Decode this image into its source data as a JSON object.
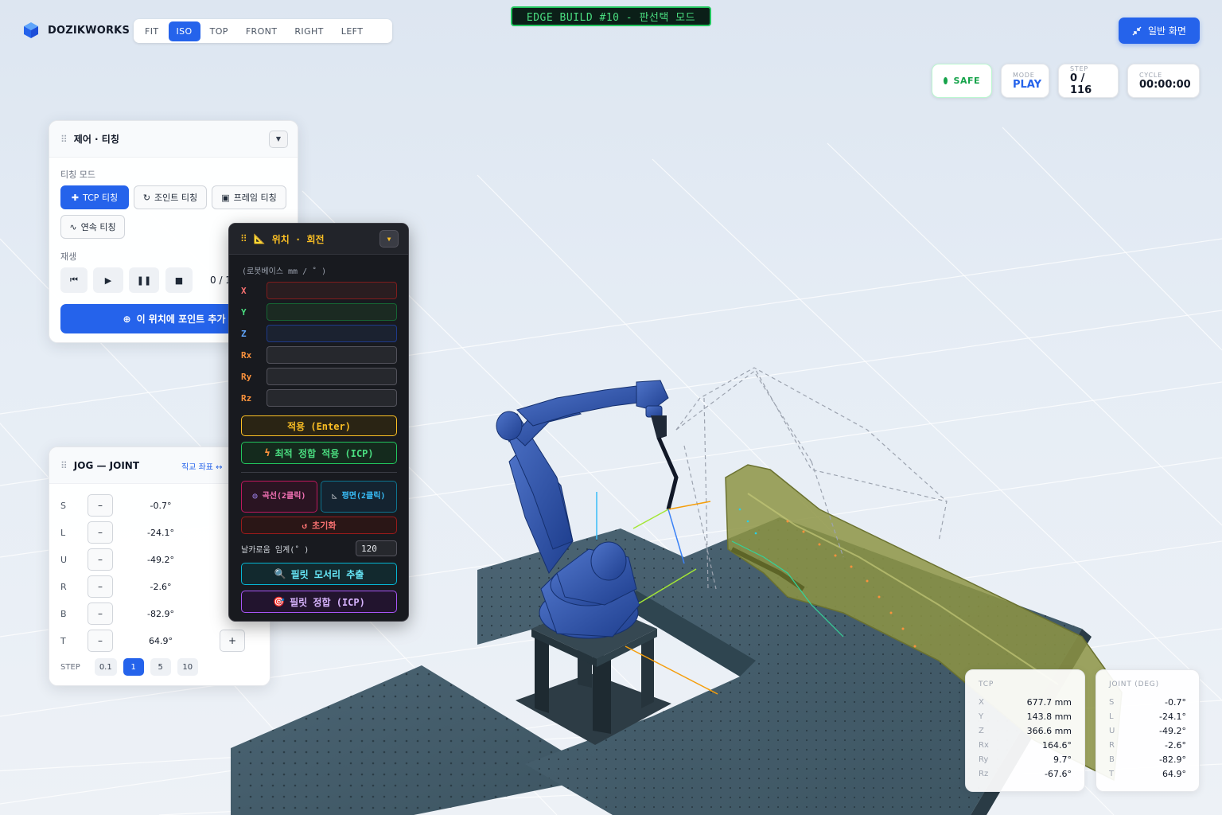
{
  "app": {
    "name": "DOZIKWORKS"
  },
  "views": [
    {
      "label": "FIT"
    },
    {
      "label": "ISO",
      "active": true
    },
    {
      "label": "TOP"
    },
    {
      "label": "FRONT"
    },
    {
      "label": "RIGHT"
    },
    {
      "label": "LEFT"
    }
  ],
  "build_badge": "EDGE BUILD #10 - 판선택 모드",
  "normal_view_button": "일반 화면",
  "status": {
    "safe": "SAFE",
    "mode_label": "MODE",
    "mode_value": "PLAY",
    "step_label": "STEP",
    "step_value": "0 / 116",
    "cycle_label": "CYCLE",
    "cycle_value": "00:00:00"
  },
  "control_panel": {
    "title": "제어 · 티칭",
    "teach_mode_label": "티칭 모드",
    "teach_buttons": [
      "TCP 티칭",
      "조인트 티칭",
      "프레임 티칭",
      "연속 티칭"
    ],
    "playback_label": "재생",
    "counter": "0 / 1",
    "add_point": "이 위치에 포인트 추가"
  },
  "position_panel": {
    "title": "위치 · 회전",
    "note": "(로봇베이스 mm / ˚ )",
    "axes": [
      "X",
      "Y",
      "Z",
      "Rx",
      "Ry",
      "Rz"
    ],
    "apply": "적용 (Enter)",
    "best_fit": "최적 정합 적용 (ICP)",
    "curve": "곡선(2클릭)",
    "plane": "평면(2클릭)",
    "reset": "초기화",
    "threshold_label": "날카로움 임계(˚ )",
    "threshold_value": "120",
    "fillet_extract": "필릿 모서리 추출",
    "fillet_match": "필릿 정합 (ICP)"
  },
  "jog_panel": {
    "title": "JOG — JOINT",
    "coord_link": "직교 좌표 ↔",
    "joints": [
      {
        "name": "S",
        "value": "-0.7°"
      },
      {
        "name": "L",
        "value": "-24.1°"
      },
      {
        "name": "U",
        "value": "-49.2°"
      },
      {
        "name": "R",
        "value": "-2.6°"
      },
      {
        "name": "B",
        "value": "-82.9°"
      },
      {
        "name": "T",
        "value": "64.9°"
      }
    ],
    "step_label": "STEP",
    "steps": [
      "0.1",
      "1",
      "5",
      "10"
    ],
    "active_step": "1"
  },
  "tcp_readout": {
    "title": "TCP",
    "rows": [
      {
        "k": "X",
        "v": "677.7 mm"
      },
      {
        "k": "Y",
        "v": "143.8 mm"
      },
      {
        "k": "Z",
        "v": "366.6 mm"
      },
      {
        "k": "Rx",
        "v": "164.6°"
      },
      {
        "k": "Ry",
        "v": "9.7°"
      },
      {
        "k": "Rz",
        "v": "-67.6°"
      }
    ]
  },
  "joint_readout": {
    "title": "JOINT (DEG)",
    "rows": [
      {
        "k": "S",
        "v": "-0.7°"
      },
      {
        "k": "L",
        "v": "-24.1°"
      },
      {
        "k": "U",
        "v": "-49.2°"
      },
      {
        "k": "R",
        "v": "-2.6°"
      },
      {
        "k": "B",
        "v": "-82.9°"
      },
      {
        "k": "T",
        "v": "64.9°"
      }
    ]
  },
  "colors": {
    "accent": "#2563eb",
    "safe": "#16a34a",
    "amber": "#fbbf24",
    "axis_x": "#f87171",
    "axis_y": "#4ade80",
    "axis_z": "#60a5fa",
    "axis_rot": "#fb923c"
  }
}
